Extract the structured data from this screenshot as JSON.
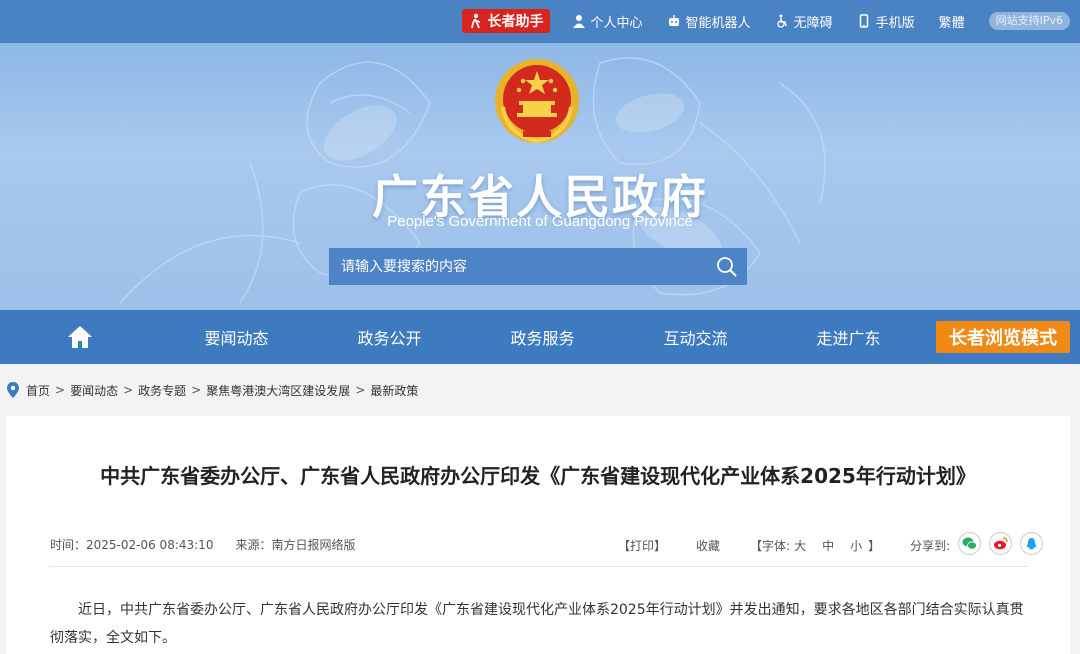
{
  "topbar": {
    "elder_assistant": "长者助手",
    "personal_center": "个人中心",
    "robot": "智能机器人",
    "accessibility": "无障碍",
    "mobile": "手机版",
    "traditional": "繁體",
    "ipv6": "网站支持IPv6"
  },
  "banner": {
    "title": "广东省人民政府",
    "subtitle": "People's Government of Guangdong Province"
  },
  "search": {
    "placeholder": "请输入要搜索的内容"
  },
  "nav": {
    "items": [
      "要闻动态",
      "政务公开",
      "政务服务",
      "互动交流",
      "走进广东"
    ],
    "elder_mode": "长者浏览模式"
  },
  "breadcrumb": [
    "首页",
    "要闻动态",
    "政务专题",
    "聚焦粤港澳大湾区建设发展",
    "最新政策"
  ],
  "article": {
    "title": "中共广东省委办公厅、广东省人民政府办公厅印发《广东省建设现代化产业体系2025年行动计划》",
    "time": "时间：2025-02-06 08:43:10",
    "source": "来源：南方日报网络版",
    "print": "【打印】",
    "favorite": "收藏",
    "font_label": "【字体:",
    "font_large": "大",
    "font_medium": "中",
    "font_small": "小",
    "font_close": "】",
    "share_label": "分享到:",
    "body": "近日，中共广东省委办公厅、广东省人民政府办公厅印发《广东省建设现代化产业体系2025年行动计划》并发出通知，要求各地区各部门结合实际认真贯彻落实，全文如下。"
  },
  "colors": {
    "topbar": "#4a83c4",
    "nav": "#3d7ac0",
    "elder_button": "#d8241c",
    "elder_mode": "#f08a14",
    "wechat": "#2aae67",
    "weibo": "#e6162d",
    "qq": "#1da1f2"
  }
}
